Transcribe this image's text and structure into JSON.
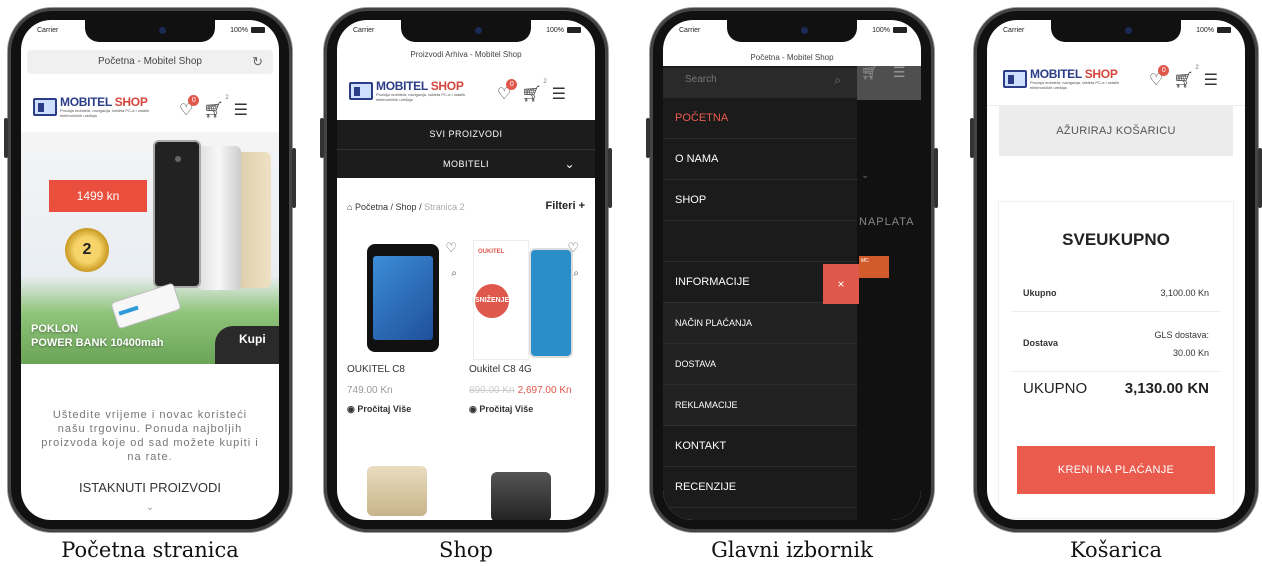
{
  "status": {
    "carrier": "Carrier",
    "battery": "100%"
  },
  "phone1": {
    "url_title": "Početna - Mobitel Shop",
    "logo": {
      "brand_a": "MOBITEL ",
      "brand_b": "SHOP",
      "tagline": "Prodaja mobitela, navigacija, tableta PC-a i ostalih elektroničkih uređaja"
    },
    "wishlist_count": "0",
    "cart_count": "2",
    "banner": {
      "price": "1499 kn",
      "warranty_years": "2",
      "promo_line1": "POKLON",
      "promo_line2": "POWER BANK 10400mah",
      "buy": "Kupi"
    },
    "intro_text": "Uštedite vrijeme i novac koristeći našu trgovinu. Ponuda najboljih proizvoda koje od sad možete kupiti i na rate.",
    "featured_heading": "ISTAKNUTI PROIZVODI",
    "caption": "Početna stranica"
  },
  "phone2": {
    "url_title": "Proizvodi Arhiva - Mobitel Shop",
    "wishlist_count": "0",
    "cart_count": "2",
    "categories": [
      "SVI PROIZVODI",
      "MOBITELI"
    ],
    "breadcrumb": {
      "home": "Početna",
      "shop": "Shop",
      "current": "Stranica 2",
      "sep": "/"
    },
    "filters_label": "Filteri",
    "products": [
      {
        "name": "OUKITEL C8",
        "price": "749.00 Kn",
        "more": "Pročitaj Više"
      },
      {
        "name": "Oukitel C8 4G",
        "old_price": "899.00 Kn",
        "price": "2,697.00 Kn",
        "badge": "SNIŽENJE",
        "more": "Pročitaj Više"
      }
    ],
    "caption": "Shop"
  },
  "phone3": {
    "url_title": "Početna - Mobitel Shop",
    "search_placeholder": "Search",
    "menu": [
      "POČETNA",
      "O NAMA",
      "SHOP"
    ],
    "info_heading": "INFORMACIJE",
    "info_items": [
      "NAČIN PLAĆANJA",
      "DOSTAVA",
      "REKLAMACIJE",
      "KONTAKT",
      "RECENZIJE"
    ],
    "close_label": "×",
    "bg_text": "NAPLATA",
    "caption": "Glavni izbornik"
  },
  "phone4": {
    "wishlist_count": "0",
    "cart_count": "2",
    "update_cart": "AŽURIRAJ KOŠARICU",
    "totals_title": "SVEUKUPNO",
    "subtotal_label": "Ukupno",
    "subtotal_value": "3,100.00 Kn",
    "shipping_label": "Dostava",
    "shipping_value_line1": "GLS dostava:",
    "shipping_value_line2": "30.00 Kn",
    "total_label": "UKUPNO",
    "total_value": "3,130.00 KN",
    "checkout": "KRENI NA PLAĆANJE",
    "caption": "Košarica"
  },
  "colors": {
    "accent": "#ea5b4e",
    "brand": "#2b3d86",
    "dark": "#1b1b1b"
  }
}
